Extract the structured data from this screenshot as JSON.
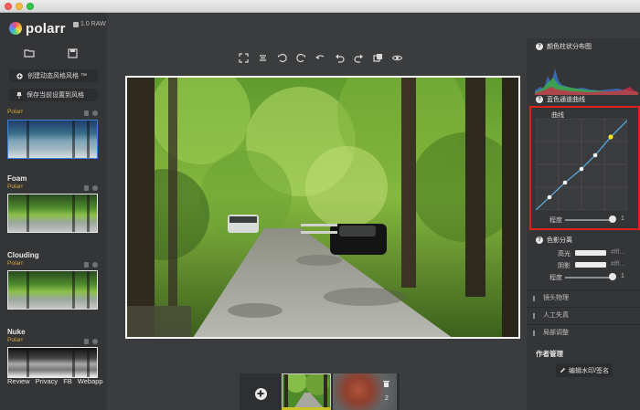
{
  "app": {
    "name": "polarr",
    "version": "1.0 RAW"
  },
  "sidebar": {
    "create_style_label": "创建动态风格风格 ™",
    "save_setting_label": "保存当前设置到风格",
    "presets": [
      {
        "name": "",
        "source": "Polarr",
        "thumb": "active"
      },
      {
        "name": "Foam",
        "source": "Polarr",
        "thumb": "green"
      },
      {
        "name": "Clouding",
        "source": "Polarr",
        "thumb": "green"
      },
      {
        "name": "Nuke",
        "source": "Polarr",
        "thumb": "bw"
      }
    ],
    "links": [
      "Review",
      "Privacy",
      "FB",
      "Webapp"
    ]
  },
  "toolbar": {
    "icons": [
      "fit-icon",
      "crop-icon",
      "rotate-left-icon",
      "rotate-right-icon",
      "history-icon",
      "undo-icon",
      "redo-icon",
      "compare-icon",
      "preview-eye-icon"
    ]
  },
  "filmstrip": {
    "count": "2"
  },
  "right_panel": {
    "histogram_title": "颜色柱状分布图",
    "curve_title": "蓝色通道曲线",
    "curve_label": "曲线",
    "strength_label": "程度",
    "strength_value": "1",
    "split_title": "色影分离",
    "highlight_label": "高光",
    "highlight_hex": "#fff...",
    "shadow_label": "阴影",
    "shadow_hex": "#fff...",
    "split_strength_label": "程度",
    "split_strength_value": "1",
    "collapsed_sections": [
      "镜头物理",
      "人工失真",
      "局部调整"
    ],
    "author_title": "作者管理",
    "author_button": "编辑水印/签名"
  },
  "colors": {
    "accent_red": "#e0201b",
    "preset_source": "#d9a53a",
    "curve_line": "#5aa6d8",
    "curve_point_active": "#f2e02a",
    "film_selected_bar": "#c9c428"
  }
}
